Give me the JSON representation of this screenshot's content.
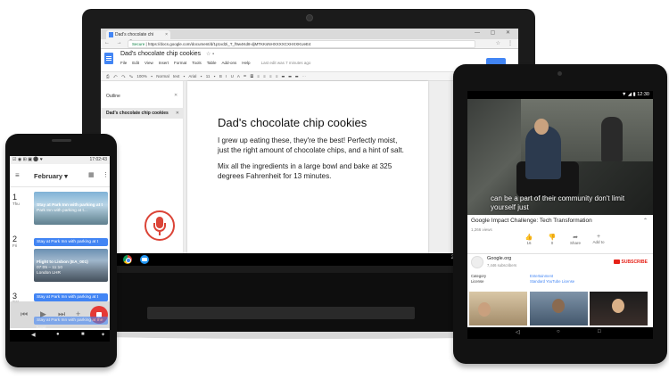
{
  "laptop": {
    "tab_title": "Dad's chocolate chi",
    "tab_close": "×",
    "window_controls": "— ▢ ✕",
    "nav_buttons": "← → C",
    "url_secure": "Secure",
    "url_text": " | https://docs.google.com/document/d/1p1vd2i_T_f9w4Kd8-djMTKKsNHXXXXCXHXXKUeE4",
    "star": "☆",
    "menu_dots": "⋮",
    "docs": {
      "title": "Dad's chocolate chip cookies",
      "title_icons": "☆ ▪",
      "menu": [
        "File",
        "Edit",
        "View",
        "Insert",
        "Format",
        "Tools",
        "Table",
        "Add-ons",
        "Help"
      ],
      "last_edit": "Last edit was 7 minutes ago",
      "toolbar_text": "⎙ ↶ ↷ ✎ 100% ▾  Normal text ▾  Arial ▾  11 ▾  B I U A  ⚭ ▤  ≡ ≡ ≡ ≡  ☰ ☰ ☰  ⋯"
    },
    "outline": {
      "title": "Outline",
      "close": "✕",
      "item": "Dad's chocolate chip cookies",
      "item_close": "✕"
    },
    "document": {
      "heading": "Dad's chocolate chip cookies",
      "para1": "I grew up eating these, they're the best! Perfectly moist, just the right amount of chocolate chips, and a hint of salt.",
      "para2": "Mix all the ingredients in a large bowl and bake at 325 degrees Fahrenheit for 13 minutes."
    },
    "shelf_number": "2"
  },
  "phone": {
    "status_icons": "☑ ◉ ⊞ ▣ ⚫ ♥",
    "status_time": "17:02:43",
    "hamburger": "≡",
    "month": "February ▾",
    "calendar_icon": "▦",
    "more": "⋮",
    "days": [
      {
        "num": "1",
        "dow": "Thu"
      },
      {
        "num": "2",
        "dow": "Fri"
      },
      {
        "num": "3",
        "dow": "Sat"
      }
    ],
    "events": {
      "card1_title": "Stay at Park Inn with parking at t",
      "card1_sub": "Park Inn with parking at t...",
      "blue1": "Stay at Park Inn with parking at t",
      "blue2": "Stay at Park Inn with parking at t",
      "card2_title": "Flight to Lisbon (EA_001)",
      "card2_sub1": "07:05 – 11:10",
      "card2_sub2": "London LHR",
      "blue3": "Stay at Park Inn with parking at t",
      "blue4": "Stay at Park Inn with parking at the hotel"
    },
    "fab_bar": {
      "prev": "⏮",
      "play": "▶",
      "next": "⏭",
      "plus": "+"
    },
    "nav": {
      "back": "◀",
      "home": "●",
      "recent": "■",
      "extra": "✦"
    }
  },
  "tablet": {
    "status": "▼ ◢ ▮ 12:30",
    "caption": "can be a part of their community don't limit yourself just",
    "video_title": "Google Impact Challenge: Tech Transformation",
    "title_chevron": "⌃",
    "views": "1,266 views",
    "actions": [
      {
        "icon": "👍",
        "label": "16"
      },
      {
        "icon": "👎",
        "label": "0"
      },
      {
        "icon": "➦",
        "label": "Share"
      },
      {
        "icon": "+",
        "label": "Add to"
      }
    ],
    "channel": "Google.org",
    "subscribers": "7,446 subscribers",
    "subscribe": "SUBSCRIBE",
    "meta_labels": [
      "Category",
      "License"
    ],
    "meta_values": [
      "Entertainment",
      "Standard YouTube License"
    ],
    "nav": {
      "back": "◁",
      "home": "○",
      "recent": "□"
    }
  },
  "colors": {
    "docs_blue": "#4285f4",
    "mic_red": "#db4437",
    "subscribe_red": "#e62117",
    "calendar_event_blue": "#4285f4"
  }
}
